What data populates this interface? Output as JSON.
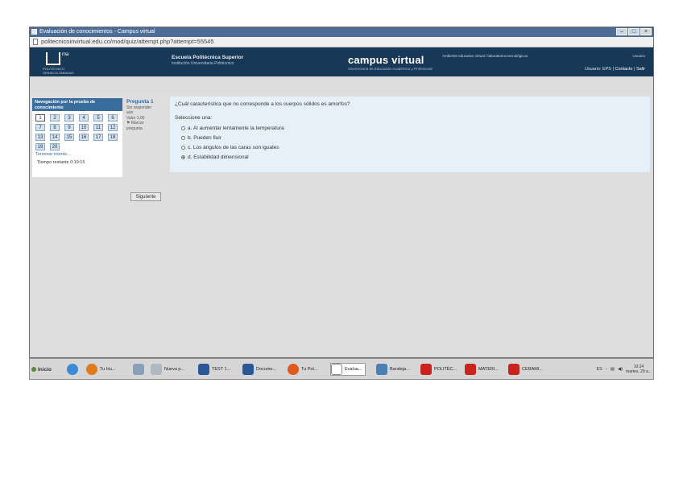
{
  "window": {
    "title": "Evaluación de conocimientos - Campus virtual"
  },
  "address": {
    "url": "politecnicoinvirtual.edu.co/mod/quiz/attempt.php?attempt=55545"
  },
  "header": {
    "logo_sup": "ma",
    "logo_sub": "POLITÉCNICO\nGRANCOLOMBIANO",
    "school_name": "Escuela Politécnica Superior",
    "school_sub": "Institución Universitaria Politécnico",
    "campus_title": "campus virtual",
    "campus_tagline": "Ambiente educativo virtual / laboratorios tecnológicos",
    "campus_sub": "Vicerrectoría de Educación Académica y Profesional",
    "user_label": "Usuario",
    "links": [
      "Usuario: EPS",
      "Contacto",
      "Salir"
    ]
  },
  "nav": {
    "title": "Navegación por la prueba de conocimiento",
    "questions": [
      "1",
      "2",
      "3",
      "4",
      "5",
      "6",
      "7",
      "8",
      "9",
      "10",
      "11",
      "12",
      "13",
      "14",
      "15",
      "16",
      "17",
      "18",
      "19",
      "20"
    ],
    "current": "1",
    "finish_label": "Terminar intento...",
    "time_label": "Tiempo restante 0:19:15"
  },
  "question": {
    "number_label": "Pregunta 1",
    "status": "Sin responder aún",
    "points": "Valor 1,00",
    "flag_label": "Marcar pregunta",
    "text": "¿Cuál característica que no corresponde a los cuerpos sólidos es amorfos?",
    "prompt": "Seleccione una:",
    "options": [
      {
        "label": "a. Al aumentar lentamente la temperatura",
        "selected": false
      },
      {
        "label": "b. Pueden fluir",
        "selected": false
      },
      {
        "label": "c. Los ángulos de las caras son iguales",
        "selected": false
      },
      {
        "label": "d. Estabilidad dimensional",
        "selected": true
      }
    ]
  },
  "next_button": "Siguiente",
  "taskbar": {
    "start": "Inicio",
    "items": [
      "Tu Hu...",
      "",
      "Nueva p...",
      "TEST 1...",
      "Docume...",
      "Tu Pol...",
      "Evalua...",
      "Bandeja...",
      "POLITÉC...",
      "MATERI...",
      "CERAMI..."
    ],
    "clock": "10:24",
    "clock_sub": "martes, 29 a..."
  },
  "colors": {
    "header_bg": "#173856",
    "nav_title_bg": "#3b6c9e",
    "question_bg": "#e5f0f8"
  }
}
